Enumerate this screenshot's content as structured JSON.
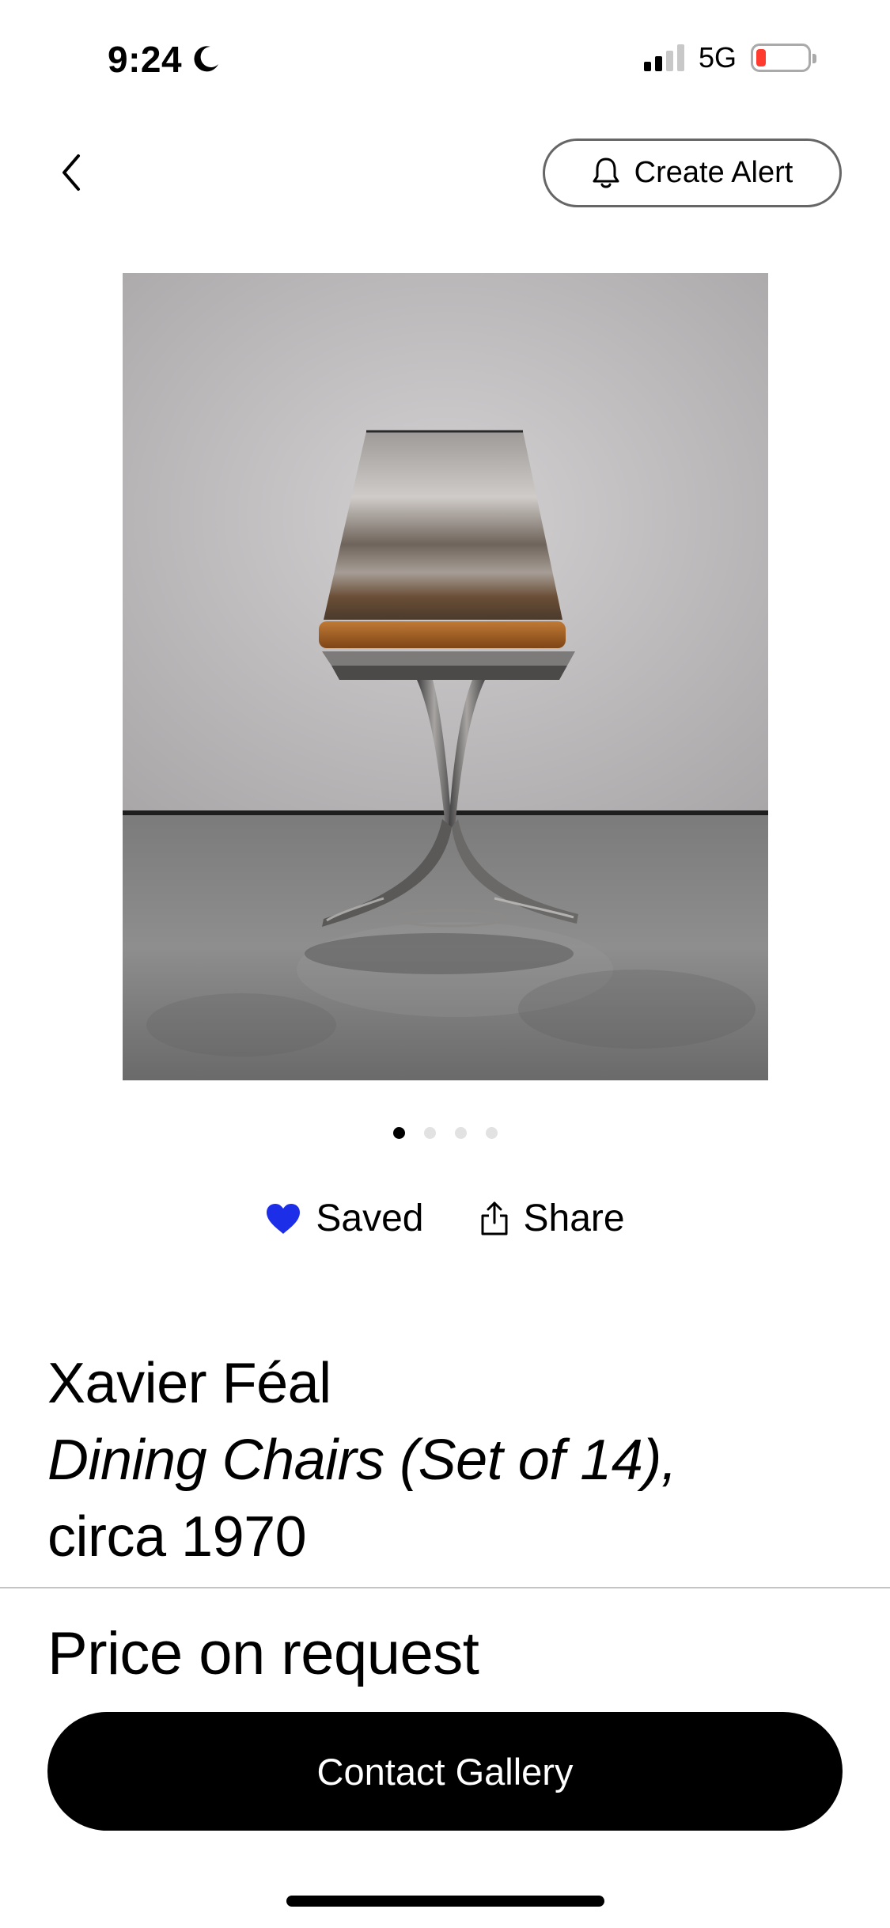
{
  "status_bar": {
    "time": "9:24",
    "network": "5G",
    "icons": [
      "moon-icon",
      "signal-icon",
      "battery-icon"
    ]
  },
  "nav": {
    "back_icon": "chevron-left-icon",
    "create_alert_label": "Create Alert",
    "create_alert_icon": "bell-icon"
  },
  "carousel": {
    "total": 4,
    "active_index": 0
  },
  "actions": {
    "saved_label": "Saved",
    "saved_icon": "heart-icon",
    "share_label": "Share",
    "share_icon": "share-icon"
  },
  "artwork": {
    "artist": "Xavier Féal",
    "title": "Dining Chairs (Set of 14),",
    "date": "circa 1970",
    "price": "Price on request"
  },
  "cta": {
    "contact_label": "Contact Gallery"
  },
  "colors": {
    "accent_heart": "#1c2ee8",
    "button_bg": "#000000",
    "button_text": "#ffffff",
    "battery_low": "#ff3b30"
  }
}
